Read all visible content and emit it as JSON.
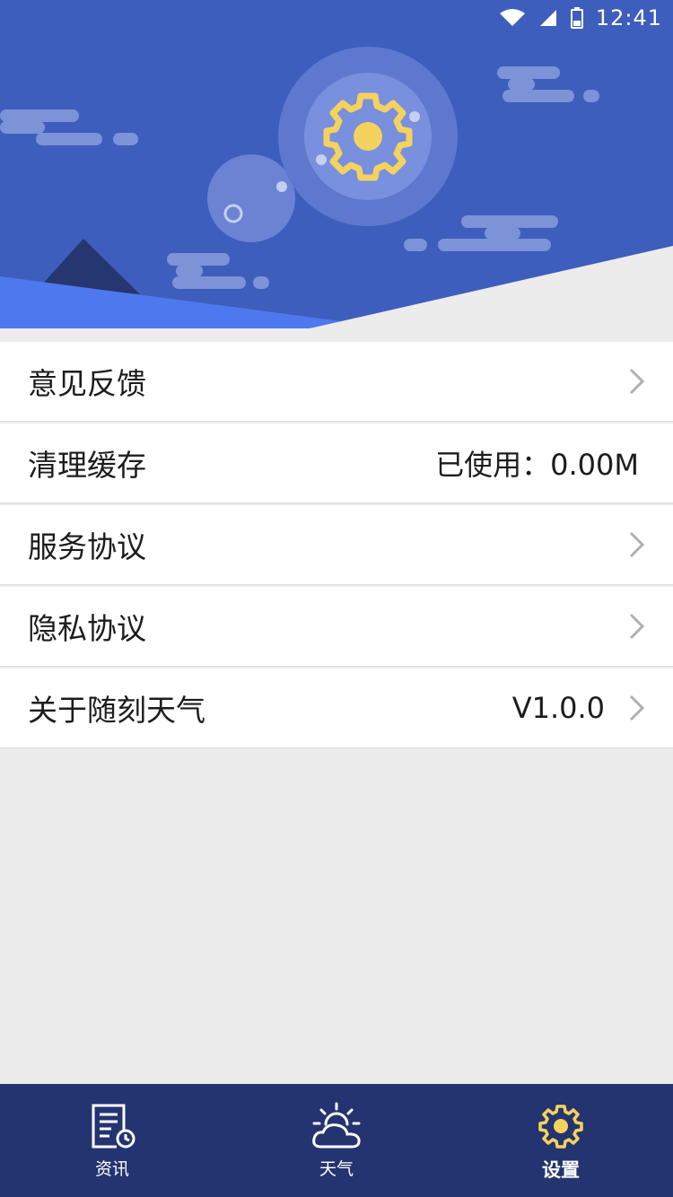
{
  "status_bar": {
    "time": "12:41",
    "icons": [
      "wifi-icon",
      "signal-icon",
      "battery-icon"
    ]
  },
  "header": {
    "illustration": "settings-gear-illustration",
    "colors": {
      "bg": "#3e5ebd",
      "gear": "#f5d25e",
      "hill": "#4e79ee",
      "mountain": "#253670"
    }
  },
  "menu": {
    "items": [
      {
        "label": "意见反馈",
        "value": "",
        "has_chevron": true
      },
      {
        "label": "清理缓存",
        "value": "已使用：0.00M",
        "has_chevron": false
      },
      {
        "label": "服务协议",
        "value": "",
        "has_chevron": true
      },
      {
        "label": "隐私协议",
        "value": "",
        "has_chevron": true
      },
      {
        "label": "关于随刻天气",
        "value": "V1.0.0",
        "has_chevron": true
      }
    ]
  },
  "tabbar": {
    "bg": "#243470",
    "tabs": [
      {
        "label": "资讯",
        "icon": "news-icon",
        "active": false
      },
      {
        "label": "天气",
        "icon": "weather-icon",
        "active": false
      },
      {
        "label": "设置",
        "icon": "settings-icon",
        "active": true
      }
    ],
    "active_color": "#f5d25e"
  }
}
